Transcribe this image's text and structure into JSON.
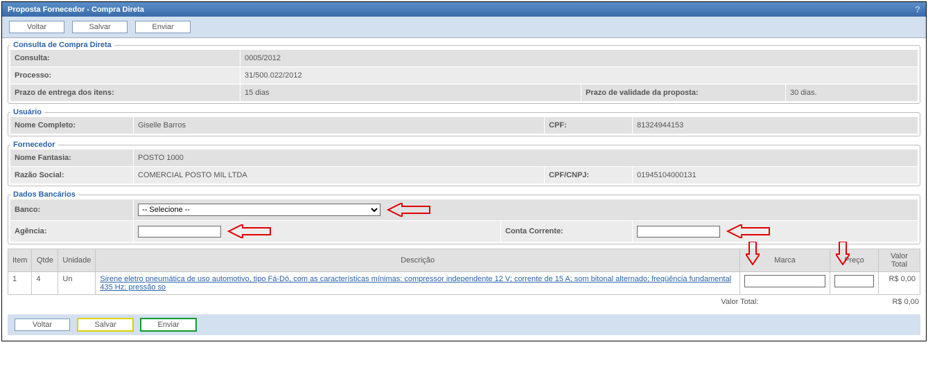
{
  "window": {
    "title": "Proposta Fornecedor - Compra Direta"
  },
  "buttons": {
    "voltar": "Voltar",
    "salvar": "Salvar",
    "enviar": "Enviar"
  },
  "consulta": {
    "legend": "Consulta de Compra Direta",
    "consulta_label": "Consulta:",
    "consulta_value": "0005/2012",
    "processo_label": "Processo:",
    "processo_value": "31/500.022/2012",
    "prazo_entrega_label": "Prazo de entrega dos itens:",
    "prazo_entrega_value": "15 dias",
    "prazo_validade_label": "Prazo de validade da proposta:",
    "prazo_validade_value": "30 dias."
  },
  "usuario": {
    "legend": "Usuário",
    "nome_label": "Nome Completo:",
    "nome_value": "Giselle Barros",
    "cpf_label": "CPF:",
    "cpf_value": "81324944153"
  },
  "fornecedor": {
    "legend": "Fornecedor",
    "fantasia_label": "Nome Fantasia:",
    "fantasia_value": "POSTO 1000",
    "razao_label": "Razão Social:",
    "razao_value": "COMERCIAL POSTO MIL LTDA",
    "cpfcnpj_label": "CPF/CNPJ:",
    "cpfcnpj_value": "01945104000131"
  },
  "bancarios": {
    "legend": "Dados Bancários",
    "banco_label": "Banco:",
    "banco_selected": "-- Selecione --",
    "agencia_label": "Agência:",
    "agencia_value": "",
    "conta_label": "Conta Corrente:",
    "conta_value": ""
  },
  "items_table": {
    "headers": {
      "item": "Item",
      "qtde": "Qtde",
      "unidade": "Unidade",
      "descricao": "Descrição",
      "marca": "Marca",
      "preco": "Preço",
      "valor_total": "Valor Total"
    },
    "rows": [
      {
        "item": "1",
        "qtde": "4",
        "unidade": "Un",
        "descricao": "Sirene eletro pneumática de uso automotivo, tipo Fá-Dó, com as características mínimas: compressor independente 12 V; corrente de 15 A; som bitonal alternado; freqüência fundamental 435 Hz; pressão so",
        "marca": "",
        "preco": "",
        "valor_total": "R$ 0,00"
      }
    ],
    "total_label": "Valor Total:",
    "total_value": "R$ 0,00"
  }
}
